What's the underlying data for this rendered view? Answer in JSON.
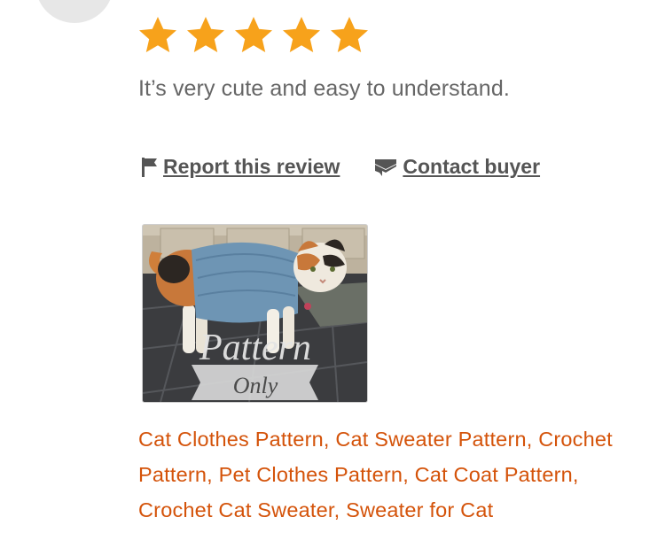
{
  "review": {
    "rating": 5,
    "max_rating": 5,
    "star_color": "#f7a21b",
    "text": "It’s very cute and easy to understand."
  },
  "actions": {
    "report_label": "Report this review",
    "report_icon": "flag-icon",
    "contact_label": "Contact buyer",
    "contact_icon": "envelope-icon"
  },
  "photo": {
    "overlay_title": "Pattern",
    "overlay_subtitle": "Only"
  },
  "item": {
    "title": "Cat Clothes Pattern, Cat Sweater Pattern, Crochet Pattern, Pet Clothes Pattern, Cat Coat Pattern, Crochet Cat Sweater, Sweater for Cat",
    "link_color": "#d4530a"
  }
}
